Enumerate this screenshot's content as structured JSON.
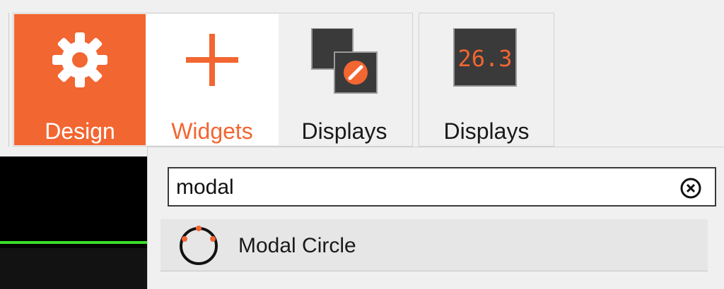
{
  "toolbar": {
    "tools": [
      {
        "id": "design",
        "label": "Design",
        "icon": "gear-icon",
        "active": true
      },
      {
        "id": "widgets",
        "label": "Widgets",
        "icon": "plus-icon",
        "selected": true
      },
      {
        "id": "displays",
        "label": "Displays",
        "icon": "displays-icon"
      },
      {
        "id": "displays-dropdown",
        "label": "Displays",
        "icon": "digital-readout-icon",
        "readout": "26.3",
        "has_dropdown": true
      }
    ]
  },
  "popup": {
    "search": {
      "value": "modal",
      "clear_icon": "clear-circle-x-icon"
    },
    "results": [
      {
        "label": "Modal Circle",
        "icon": "modal-circle-icon"
      }
    ]
  },
  "colors": {
    "accent": "#f26631",
    "readout_bg": "#3a3a3a",
    "readout_text": "#f26631",
    "green_trace": "#3cdc2a"
  }
}
